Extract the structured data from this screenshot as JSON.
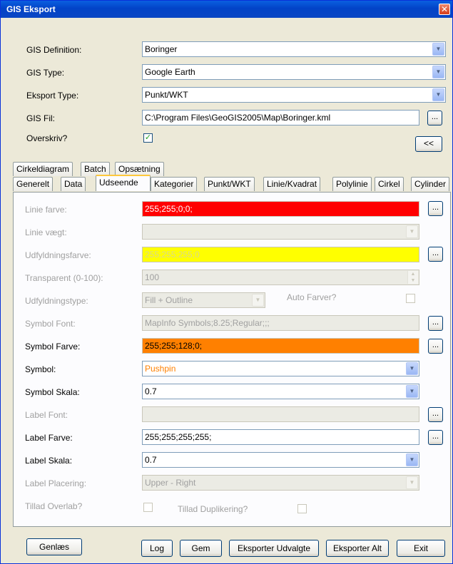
{
  "window": {
    "title": "GIS Eksport",
    "close_glyph": "✕"
  },
  "top": {
    "gis_definition_label": "GIS Definition:",
    "gis_definition_value": "Boringer",
    "gis_type_label": "GIS Type:",
    "gis_type_value": "Google Earth",
    "eksport_type_label": "Eksport Type:",
    "eksport_type_value": "Punkt/WKT",
    "gis_fil_label": "GIS Fil:",
    "gis_fil_value": "C:\\Program Files\\GeoGIS2005\\Map\\Boringer.kml",
    "browse_label": "...",
    "overskriv_label": "Overskriv?",
    "overskriv_checked": "✓",
    "collapse_label": "<<"
  },
  "tabs_row1": [
    "Cirkeldiagram",
    "Batch",
    "Opsætning"
  ],
  "tabs_row2": [
    "Generelt",
    "Data",
    "Udseende",
    "Kategorier",
    "Punkt/WKT",
    "Linie/Kvadrat",
    "Polylinie",
    "Cirkel",
    "Cylinder"
  ],
  "panel": {
    "linie_farve_label": "Linie farve:",
    "linie_farve_value": "255;255;0;0;",
    "linie_farve_color": "#ff0000",
    "linie_vaegt_label": "Linie vægt:",
    "udfyldningsfarve_label": "Udfyldningsfarve:",
    "udfyldningsfarve_value": "255;255;255;0",
    "udfyldningsfarve_color": "#ffff00",
    "transparent_label": "Transparent (0-100):",
    "transparent_value": "100",
    "udfyldningstype_label": "Udfyldningstype:",
    "udfyldningstype_value": "Fill + Outline",
    "auto_farver_label": "Auto Farver?",
    "symbol_font_label": "Symbol Font:",
    "symbol_font_value": "MapInfo Symbols;8.25;Regular;;;",
    "symbol_farve_label": "Symbol Farve:",
    "symbol_farve_value": "255;255;128;0;",
    "symbol_farve_color": "#ff8000",
    "symbol_label": "Symbol:",
    "symbol_value": "Pushpin",
    "symbol_value_color": "#ff8000",
    "symbol_skala_label": "Symbol Skala:",
    "symbol_skala_value": "0.7",
    "label_font_label": "Label Font:",
    "label_farve_label": "Label Farve:",
    "label_farve_value": "255;255;255;255;",
    "label_skala_label": "Label Skala:",
    "label_skala_value": "0.7",
    "label_placering_label": "Label Placering:",
    "label_placering_value": "Upper - Right",
    "tillad_overlab_label": "Tillad Overlab?",
    "tillad_duplikering_label": "Tillad Duplikering?",
    "browse_label": "..."
  },
  "footer": {
    "genlaes": "Genlæs",
    "log": "Log",
    "gem": "Gem",
    "eksporter_udvalgte": "Eksporter Udvalgte",
    "eksporter_alt": "Eksporter Alt",
    "exit": "Exit"
  }
}
